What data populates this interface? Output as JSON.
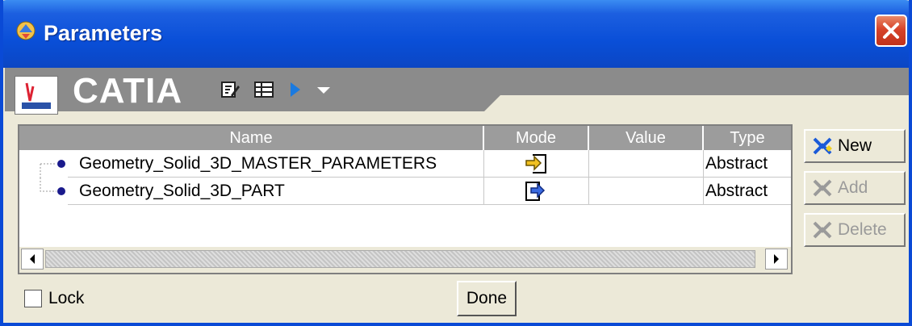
{
  "window": {
    "title": "Parameters"
  },
  "toolbar": {
    "brand": "CATIA"
  },
  "table": {
    "columns": [
      "Name",
      "Mode",
      "Value",
      "Type"
    ],
    "rows": [
      {
        "name": "Geometry_Solid_3D_MASTER_PARAMETERS",
        "mode_icon": "import-icon",
        "value": "",
        "type": "Abstract"
      },
      {
        "name": "Geometry_Solid_3D_PART",
        "mode_icon": "export-icon",
        "value": "",
        "type": "Abstract"
      }
    ]
  },
  "buttons": {
    "new": "New",
    "add": "Add",
    "delete": "Delete",
    "done": "Done"
  },
  "lock": {
    "label": "Lock",
    "checked": false
  },
  "colors": {
    "titlebar": "#0a4fd8",
    "header": "#9c9c9c",
    "bullet": "#1a1a8c"
  }
}
